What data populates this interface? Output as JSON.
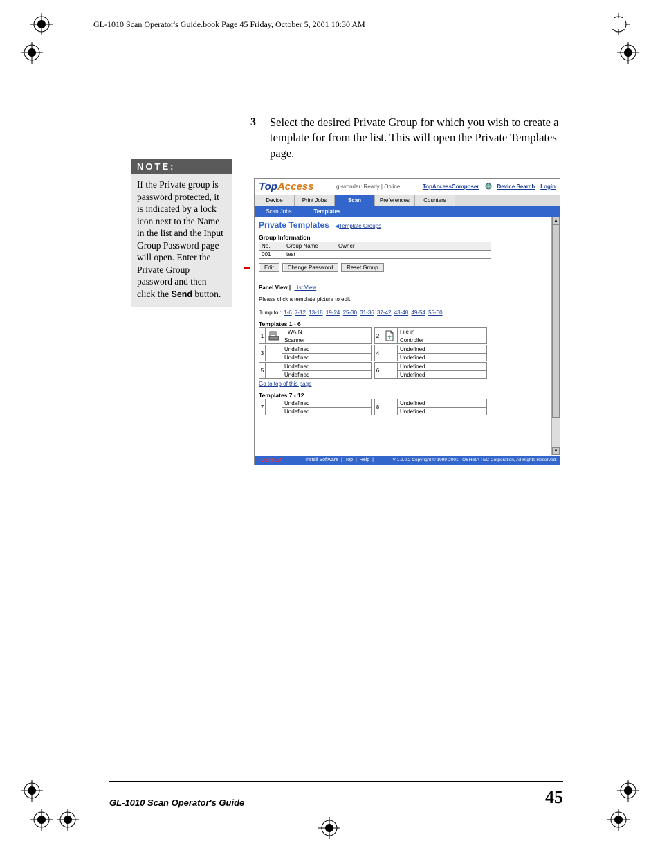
{
  "header": {
    "text": "GL-1010 Scan Operator's Guide.book  Page 45  Friday, October 5, 2001  10:30 AM"
  },
  "step": {
    "num": "3",
    "text": "Select the desired Private Group for which you wish to create a template for from the list. This will open the Private Templates page."
  },
  "note": {
    "heading": "NOTE:",
    "body_pre": "If the Private group is password protected, it is indicated by a lock icon next to the Name in the list and the Input Group Password page will open. Enter the Private Group password and then click the ",
    "body_bold": "Send",
    "body_post": " button."
  },
  "screenshot": {
    "logo_pre": "Top",
    "logo_post": "Access",
    "status": "gl-wonder: Ready | Online",
    "links": {
      "composer": "TopAccessComposer",
      "search": "Device Search",
      "login": "Login"
    },
    "tabs": [
      "Device",
      "Print Jobs",
      "Scan",
      "Preferences",
      "Counters"
    ],
    "subtabs": [
      "Scan Jobs",
      "Templates"
    ],
    "pt_title": "Private Templates",
    "bc_arrow": "◀",
    "bc_link": "Template Groups",
    "gi_heading": "Group Information",
    "gi_headers": [
      "No.",
      "Group Name",
      "Owner"
    ],
    "gi_row": [
      "001",
      "test",
      ""
    ],
    "buttons": {
      "edit": "Edit",
      "changepw": "Change Password",
      "reset": "Reset Group"
    },
    "views": {
      "panel": "Panel View",
      "sep": " | ",
      "list": "List View"
    },
    "instruction": "Please click a template picture to edit.",
    "jump_label": "Jump to :",
    "jump_ranges": [
      "1-6",
      "7-12",
      "13-18",
      "19-24",
      "25-30",
      "31-36",
      "37-42",
      "43-48",
      "49-54",
      "55-60"
    ],
    "tmpl1_head": "Templates  1 - 6",
    "tmpl1": [
      {
        "n": "1",
        "a": "TWAIN",
        "b": "Scanner",
        "icon": "scanner"
      },
      {
        "n": "2",
        "a": "File in",
        "b": "Controller",
        "icon": "file"
      },
      {
        "n": "3",
        "a": "Undefined",
        "b": "Undefined",
        "icon": ""
      },
      {
        "n": "4",
        "a": "Undefined",
        "b": "Undefined",
        "icon": ""
      },
      {
        "n": "5",
        "a": "Undefined",
        "b": "Undefined",
        "icon": ""
      },
      {
        "n": "6",
        "a": "Undefined",
        "b": "Undefined",
        "icon": ""
      }
    ],
    "gototop": "Go to top of this page",
    "tmpl2_head": "Templates  7 - 12",
    "tmpl2": [
      {
        "n": "7",
        "a": "Undefined",
        "b": "Undefined",
        "icon": ""
      },
      {
        "n": "8",
        "a": "Undefined",
        "b": "Undefined",
        "icon": ""
      }
    ],
    "footer": {
      "brand": "TOSHIBA",
      "links": [
        "Install Software",
        "Top",
        "Help"
      ],
      "copy": "V 1.2.0.2  Copyright © 1999-2001 TOSHIBA TEC Corporation, All Rights Reserved."
    }
  },
  "docfooter": {
    "title": "GL-1010 Scan Operator's Guide",
    "page": "45"
  }
}
